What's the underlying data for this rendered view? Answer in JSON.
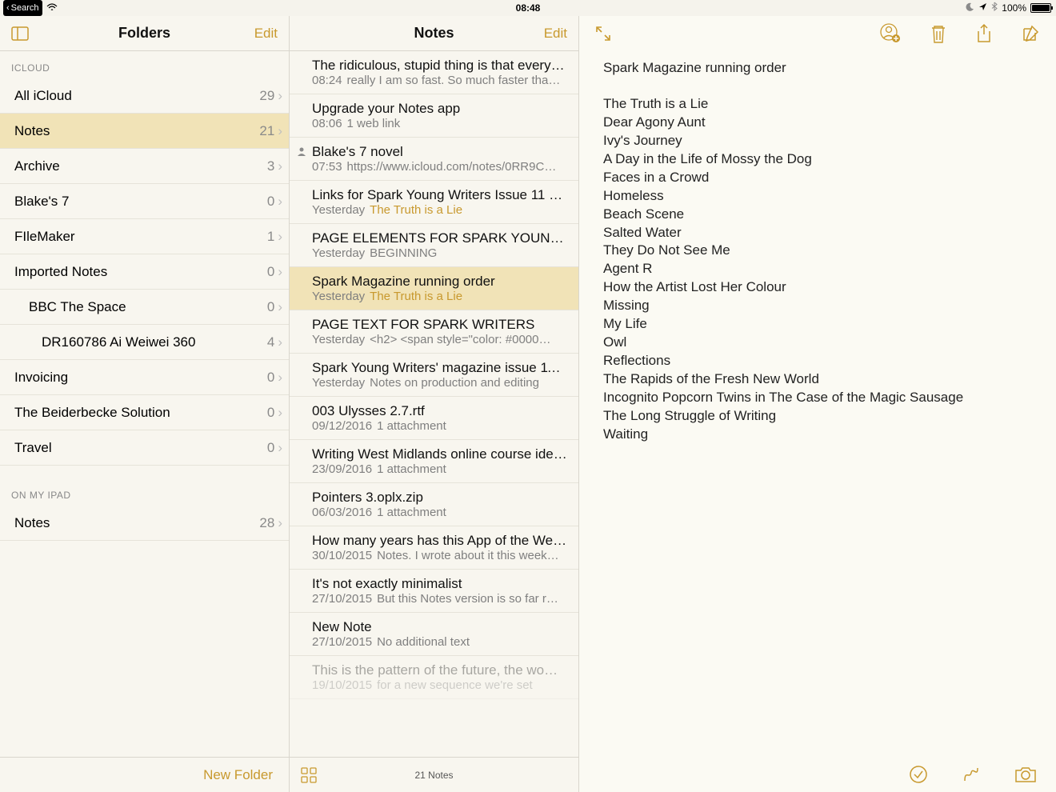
{
  "status": {
    "back_label": "Search",
    "time": "08:48",
    "battery_pct": "100%"
  },
  "folders_nav": {
    "title": "Folders",
    "edit": "Edit"
  },
  "notes_nav": {
    "title": "Notes",
    "edit": "Edit"
  },
  "sections": {
    "icloud": {
      "header": "ICLOUD",
      "items": [
        {
          "name": "All iCloud",
          "count": "29",
          "indent": 0
        },
        {
          "name": "Notes",
          "count": "21",
          "indent": 0,
          "selected": true
        },
        {
          "name": "Archive",
          "count": "3",
          "indent": 0
        },
        {
          "name": "Blake's 7",
          "count": "0",
          "indent": 0
        },
        {
          "name": "FIleMaker",
          "count": "1",
          "indent": 0
        },
        {
          "name": "Imported Notes",
          "count": "0",
          "indent": 0
        },
        {
          "name": "BBC The Space",
          "count": "0",
          "indent": 1
        },
        {
          "name": "DR160786 Ai Weiwei 360",
          "count": "4",
          "indent": 2
        },
        {
          "name": "Invoicing",
          "count": "0",
          "indent": 0
        },
        {
          "name": "The Beiderbecke Solution",
          "count": "0",
          "indent": 0
        },
        {
          "name": "Travel",
          "count": "0",
          "indent": 0
        }
      ]
    },
    "onipad": {
      "header": "ON MY IPAD",
      "items": [
        {
          "name": "Notes",
          "count": "28",
          "indent": 0
        }
      ]
    }
  },
  "new_folder_label": "New Folder",
  "notes": [
    {
      "title": "The ridiculous, stupid thing is that every…",
      "date": "08:24",
      "preview": "really I am so fast. So much faster tha…"
    },
    {
      "title": "Upgrade your Notes app",
      "date": "08:06",
      "preview": "1 web link"
    },
    {
      "title": "Blake's 7 novel",
      "date": "07:53",
      "preview": "https://www.icloud.com/notes/0RR9C…",
      "shared": true
    },
    {
      "title": "Links for Spark Young Writers Issue 11 p…",
      "date": "Yesterday",
      "preview": "The Truth is a Lie",
      "gold": true
    },
    {
      "title": "PAGE ELEMENTS FOR SPARK YOUNG…",
      "date": "Yesterday",
      "preview": "BEGINNING"
    },
    {
      "title": "Spark Magazine running order",
      "date": "Yesterday",
      "preview": "The Truth is a Lie",
      "selected": true,
      "gold": true
    },
    {
      "title": "PAGE TEXT FOR SPARK WRITERS",
      "date": "Yesterday",
      "preview": "<h2> <span style=\"color: #0000…"
    },
    {
      "title": "Spark Young Writers' magazine issue 11…",
      "date": "Yesterday",
      "preview": "Notes on production and editing"
    },
    {
      "title": "003 Ulysses 2.7.rtf",
      "date": "09/12/2016",
      "preview": "1 attachment"
    },
    {
      "title": "Writing West Midlands online course ide…",
      "date": "23/09/2016",
      "preview": "1 attachment"
    },
    {
      "title": "Pointers 3.oplx.zip",
      "date": "06/03/2016",
      "preview": "1 attachment"
    },
    {
      "title": "How many years has this App of the We…",
      "date": "30/10/2015",
      "preview": "Notes. I wrote about it this week…"
    },
    {
      "title": "It's not exactly minimalist",
      "date": "27/10/2015",
      "preview": "But this Notes version is so far r…"
    },
    {
      "title": "New Note",
      "date": "27/10/2015",
      "preview": "No additional text"
    },
    {
      "title": "This is the pattern of the future, the wo…",
      "date": "19/10/2015",
      "preview": "for a new sequence we're set",
      "faded": true
    }
  ],
  "notes_count_label": "21 Notes",
  "note_detail": {
    "title": "Spark Magazine running order",
    "lines": [
      "The Truth is a Lie",
      "Dear Agony Aunt",
      "Ivy's Journey",
      "A Day in the Life of Mossy the Dog",
      "Faces in a Crowd",
      "Homeless",
      "Beach Scene",
      "Salted Water",
      "They Do Not See Me",
      "Agent R",
      "How the Artist Lost Her Colour",
      "Missing",
      "My Life",
      "Owl",
      "Reflections",
      "The Rapids of the Fresh New World",
      "Incognito Popcorn Twins in The Case of the Magic Sausage",
      "The Long Struggle of Writing",
      "Waiting"
    ]
  }
}
